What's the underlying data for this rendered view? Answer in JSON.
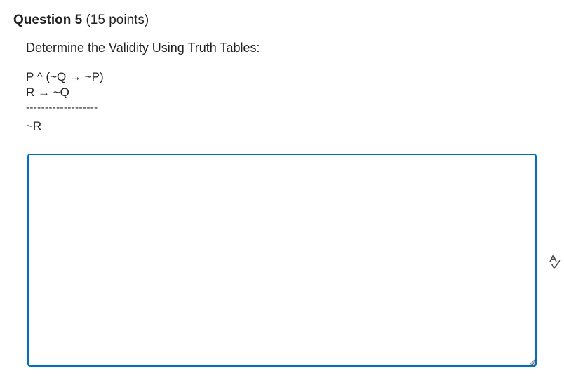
{
  "question": {
    "title": "Question 5",
    "points": "(15 points)"
  },
  "prompt": "Determine the Validity Using Truth Tables:",
  "argument": {
    "premises": [
      "P ^ (~Q → ~P)",
      "R → ~Q"
    ],
    "divider": "-------------------",
    "conclusion": "~R"
  },
  "answer": {
    "value": ""
  },
  "icons": {
    "spellcheck": "spellcheck-icon",
    "resize": "resize-grip-icon"
  },
  "colors": {
    "focus_border": "#006fbf",
    "text": "#202122"
  }
}
